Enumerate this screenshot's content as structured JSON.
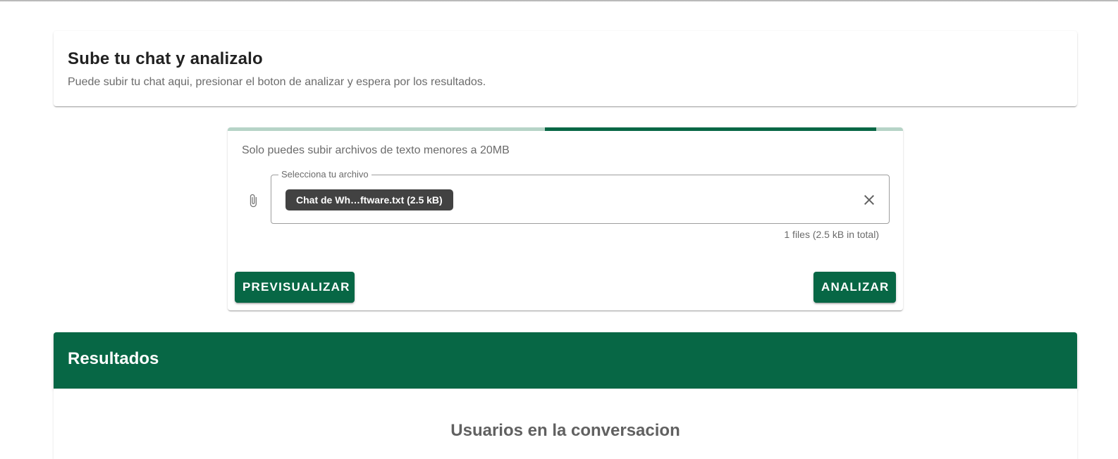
{
  "intro": {
    "title": "Sube tu chat y analizalo",
    "subtitle": "Puede subir tu chat aqui, presionar el boton de analizar y espera por los resultados."
  },
  "upload": {
    "progress_fraction": 0.96,
    "progress_start_fraction": 0.47,
    "hint": "Solo puedes subir archivos de texto menores a 20MB",
    "field_label": "Selecciona tu archivo",
    "file_chip": "Chat de Wh…ftware.txt (2.5 kB)",
    "file_summary": "1 files (2.5 kB in total)",
    "preview_button": "Previsualizar",
    "analyze_button": "Analizar",
    "icons": {
      "attach": "paperclip-icon",
      "clear": "close-icon"
    }
  },
  "results": {
    "header": "Resultados",
    "section_title": "Usuarios en la conversacion"
  },
  "colors": {
    "accent": "#076745",
    "progress_track": "#b6d4c7",
    "chip_bg": "#424242"
  }
}
